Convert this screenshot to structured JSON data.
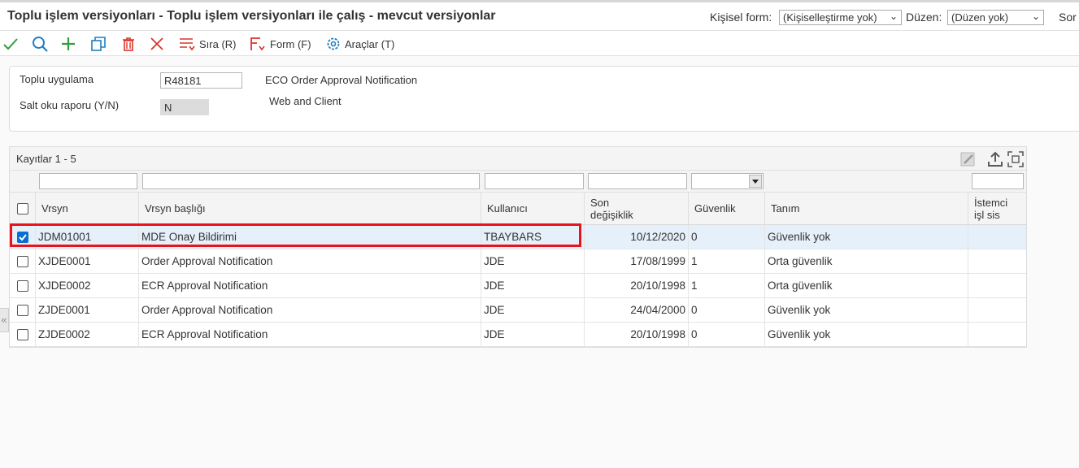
{
  "title": "Toplu işlem versiyonları - Toplu işlem versiyonları ile çalış - mevcut versiyonlar",
  "personal_form": {
    "label": "Kişisel form:",
    "value": "(Kişiselleştirme yok)"
  },
  "layout": {
    "label": "Düzen:",
    "value": "(Düzen yok)"
  },
  "cutoff_text": "Sor",
  "toolbar": {
    "sort_label": "Sıra (R)",
    "form_label": "Form (F)",
    "tools_label": "Araçlar (T)"
  },
  "form": {
    "batch_app_label": "Toplu uygulama",
    "batch_app_value": "R48181",
    "batch_app_desc": "ECO Order Approval Notification",
    "readonly_label": "Salt oku raporu (Y/N)",
    "readonly_value": "N",
    "readonly_desc": "Web and Client"
  },
  "grid": {
    "records_label": "Kayıtlar 1 - 5",
    "columns": [
      "Vrsyn",
      "Vrsyn başlığı",
      "Kullanıcı",
      "Son değişiklik",
      "Güvenlik",
      "Tanım",
      "İstemci işl sis"
    ],
    "rows": [
      {
        "checked": true,
        "version": "JDM01001",
        "title": "MDE Onay Bildirimi",
        "user": "TBAYBARS",
        "date": "10/12/2020",
        "security": "0",
        "desc": "Güvenlik yok"
      },
      {
        "checked": false,
        "version": "XJDE0001",
        "title": "Order Approval Notification",
        "user": "JDE",
        "date": "17/08/1999",
        "security": "1",
        "desc": "Orta güvenlik"
      },
      {
        "checked": false,
        "version": "XJDE0002",
        "title": "ECR Approval Notification",
        "user": "JDE",
        "date": "20/10/1998",
        "security": "1",
        "desc": "Orta güvenlik"
      },
      {
        "checked": false,
        "version": "ZJDE0001",
        "title": "Order Approval Notification",
        "user": "JDE",
        "date": "24/04/2000",
        "security": "0",
        "desc": "Güvenlik yok"
      },
      {
        "checked": false,
        "version": "ZJDE0002",
        "title": "ECR Approval Notification",
        "user": "JDE",
        "date": "20/10/1998",
        "security": "0",
        "desc": "Güvenlik yok"
      }
    ]
  },
  "colors": {
    "accent": "#0a6ed1",
    "highlight": "#e8131b",
    "ok": "#2e9e3e",
    "delete": "#d9342b"
  },
  "icons": [
    "checkmark-icon",
    "search-icon",
    "plus-icon",
    "copy-icon",
    "trash-icon",
    "close-icon",
    "sort-icon",
    "form-icon",
    "gear-icon",
    "edit-icon",
    "export-icon",
    "fullscreen-icon"
  ]
}
